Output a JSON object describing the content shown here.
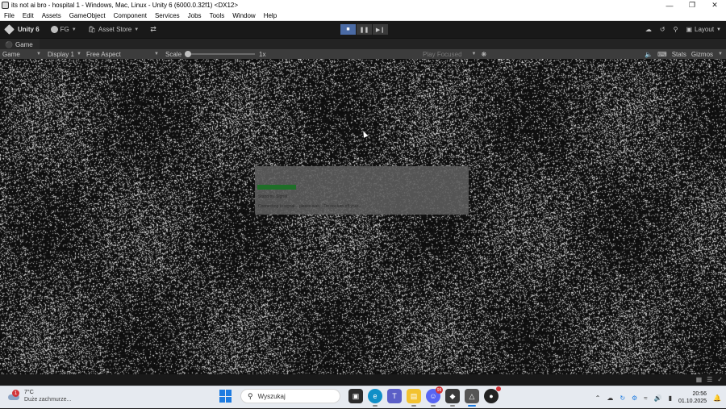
{
  "window": {
    "title": "its not ai bro - hospital 1 - Windows, Mac, Linux - Unity 6 (6000.0.32f1) <DX12>",
    "controls": [
      "minimize-icon",
      "restore-icon",
      "close-icon"
    ]
  },
  "menubar": {
    "items": [
      "File",
      "Edit",
      "Assets",
      "GameObject",
      "Component",
      "Services",
      "Jobs",
      "Tools",
      "Window",
      "Help"
    ]
  },
  "toolbar": {
    "unity_label": "Unity 6",
    "account_label": "FG",
    "asset_store_label": "Asset Store",
    "layout_label": "Layout",
    "play_active": "stop"
  },
  "tab": {
    "label": "Game"
  },
  "gameview": {
    "mode_label": "Game",
    "display_label": "Display 1",
    "aspect_label": "Free Aspect",
    "scale_label": "Scale",
    "scale_value": "1x",
    "scale_fraction": 0.0,
    "play_mode_label": "Play Focused",
    "stats_label": "Stats",
    "gizmos_label": "Gizmos"
  },
  "dialog": {
    "line1": "Stand by. Signal",
    "line2": "Connecting to signal... please wait... Do not turn off your..."
  },
  "taskbar": {
    "weather_badge": "1",
    "temperature": "7°C",
    "weather_desc": "Duże zachmurze...",
    "search_placeholder": "Wyszukaj",
    "discord_badge": "99",
    "time": "20:56",
    "date": "01.10.2025"
  },
  "colors": {
    "stop_button_active": "#4a6aa4",
    "progress_bar": "#1f6e28",
    "windows_blue": "#1e7be0"
  }
}
